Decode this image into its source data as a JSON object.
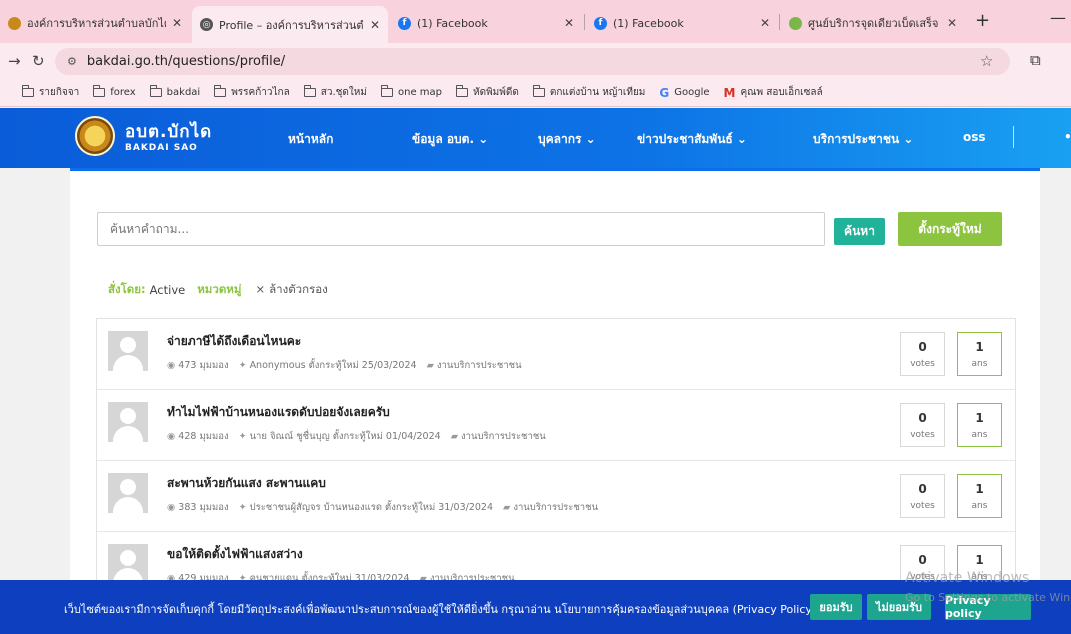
{
  "browser": {
    "tabs": [
      {
        "title": "องค์การบริหารส่วนตำบลบักได – ",
        "icon": "site-favicon",
        "icon_color": "#c8891a"
      },
      {
        "title": "Profile – องค์การบริหารส่วนตำบ",
        "icon": "globe-icon",
        "icon_color": "#555555"
      },
      {
        "title": "(1) Facebook",
        "icon": "facebook-icon",
        "icon_color": "#1877f2"
      },
      {
        "title": "(1) Facebook",
        "icon": "facebook-icon",
        "icon_color": "#1877f2"
      },
      {
        "title": "ศูนย์บริการจุดเดียวเบ็ดเสร็จ | องค์",
        "icon": "site-favicon",
        "icon_color": "#7ab648"
      }
    ],
    "url": "bakdai.go.th/questions/profile/",
    "bookmarks": [
      {
        "label": "รายกิจจา",
        "type": "folder"
      },
      {
        "label": "forex",
        "type": "folder"
      },
      {
        "label": "bakdai",
        "type": "folder"
      },
      {
        "label": "พรรคก้าวไกล",
        "type": "folder"
      },
      {
        "label": "สว.ชุดใหม่",
        "type": "folder"
      },
      {
        "label": "one map",
        "type": "folder"
      },
      {
        "label": "หัดพิมพ์ดีด",
        "type": "folder"
      },
      {
        "label": "ตกแต่งบ้าน หญ้าเทียม",
        "type": "folder"
      },
      {
        "label": "Google",
        "type": "google"
      },
      {
        "label": "คุณพ สอบเอ็กเซลล์",
        "type": "gmail"
      }
    ]
  },
  "site": {
    "logo_th": "อบต.บักได",
    "logo_en": "BAKDAI SAO",
    "nav": [
      {
        "label": "หน้าหลัก"
      },
      {
        "label": "ข้อมูล อบต. ⌄"
      },
      {
        "label": "บุคลากร ⌄"
      },
      {
        "label": "ข่าวประชาสัมพันธ์ ⌄"
      },
      {
        "label": "บริการประชาชน ⌄"
      },
      {
        "label": "oss"
      }
    ]
  },
  "search": {
    "placeholder": "ค้นหาคำถาม...",
    "search_button": "ค้นหา",
    "new_topic_button": "ตั้งกระทู้ใหม่"
  },
  "filter": {
    "sort_label": "สั่งโดย:",
    "sort_value": "Active",
    "category_label": "หมวดหมู่",
    "clear_label": "ล้างตัวกรอง"
  },
  "questions": [
    {
      "title": "จ่ายภาษีได้ถึงเดือนไหนคะ",
      "views": "473 มุมมอง",
      "author": "Anonymous ตั้งกระทู้ใหม่ 25/03/2024",
      "category": "งานบริการประชาชน",
      "votes": "0",
      "votes_label": "votes",
      "answers": "1",
      "answers_label": "ans"
    },
    {
      "title": "ทำไมไฟฟ้าบ้านหนองแรดดับบ่อยจังเลยครับ",
      "views": "428 มุมมอง",
      "author": "นาย จิณณ์ ชูชื่นบุญ ตั้งกระทู้ใหม่ 01/04/2024",
      "category": "งานบริการประชาชน",
      "votes": "0",
      "votes_label": "votes",
      "answers": "1",
      "answers_label": "ans"
    },
    {
      "title": "สะพานห้วยกันแสง สะพานแคบ",
      "views": "383 มุมมอง",
      "author": "ประชาชนผู้สัญจร บ้านหนองแรด ตั้งกระทู้ใหม่ 31/03/2024",
      "category": "งานบริการประชาชน",
      "votes": "0",
      "votes_label": "votes",
      "answers": "1",
      "answers_label": "ans"
    },
    {
      "title": "ขอให้ติดตั้งไฟฟ้าแสงสว่าง",
      "views": "429 มุมมอง",
      "author": "คนชายแดน ตั้งกระทู้ใหม่ 31/03/2024",
      "category": "งานบริการประชาชน",
      "votes": "0",
      "votes_label": "votes",
      "answers": "1",
      "answers_label": "ans"
    }
  ],
  "cookie": {
    "text": "เว็บไซต์ของเรามีการจัดเก็บคุกกี้ โดยมีวัตถุประสงค์เพื่อพัฒนาประสบการณ์ของผู้ใช้ให้ดียิ่งขึ้น กรุณาอ่าน นโยบายการคุ้มครองข้อมูลส่วนบุคคล (Privacy Policy)",
    "accept": "ยอมรับ",
    "decline": "ไม่ยอมรับ",
    "policy": "Privacy policy"
  },
  "watermark": {
    "line1": "Activate Windows",
    "line2": "Go to Settings to activate Windows."
  },
  "colors": {
    "nav_blue": "#0b5cd8",
    "green": "#8dc43f",
    "teal": "#20b39a",
    "cookie_bg": "#0d3fbf"
  }
}
